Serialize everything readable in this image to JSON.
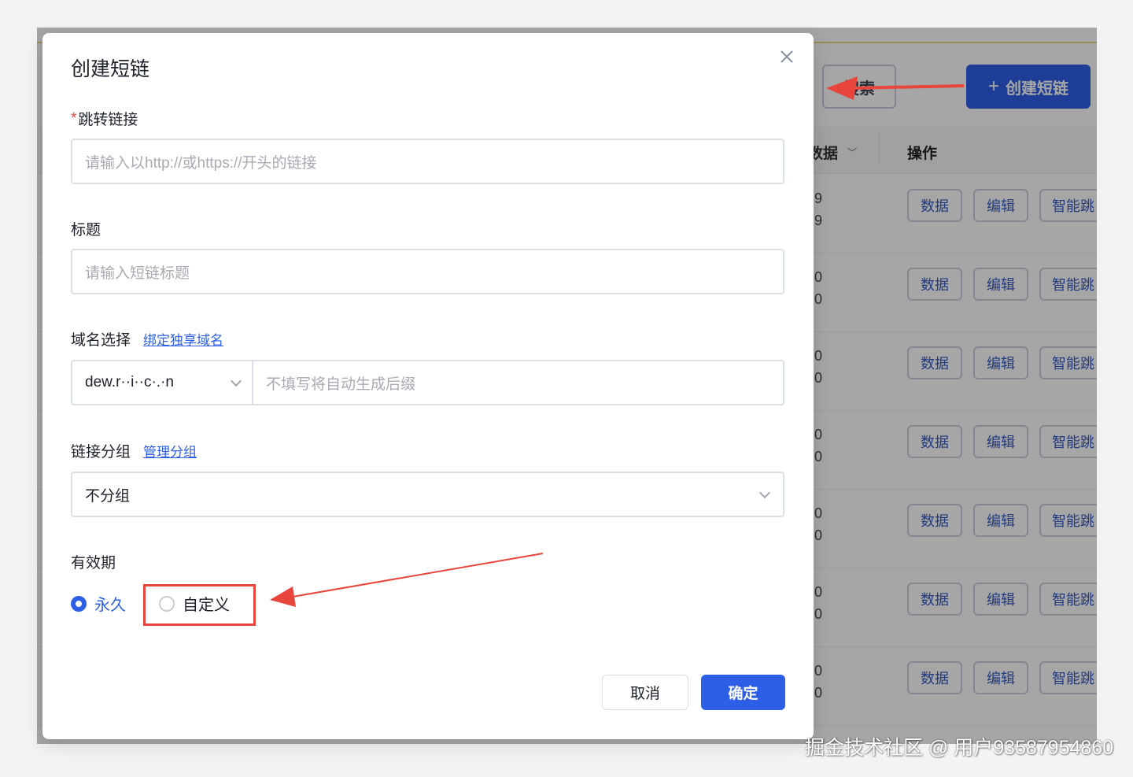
{
  "background": {
    "search_button": "搜索",
    "create_button": "创建短链",
    "create_plus": "+",
    "col_data": "数据",
    "col_op": "操作",
    "rows": [
      {
        "n1": "9",
        "n2": "9"
      },
      {
        "n1": "0",
        "n2": "0"
      },
      {
        "n1": "0",
        "n2": "0"
      },
      {
        "n1": "0",
        "n2": "0"
      },
      {
        "n1": "0",
        "n2": "0"
      },
      {
        "n1": "0",
        "n2": "0"
      },
      {
        "n1": "0",
        "n2": "0"
      }
    ],
    "row_buttons": {
      "data": "数据",
      "edit": "编辑",
      "smart": "智能跳"
    }
  },
  "modal": {
    "title": "创建短链",
    "redirect": {
      "required_mark": "*",
      "label": "跳转链接",
      "placeholder": "请输入以http://或https://开头的链接"
    },
    "title_field": {
      "label": "标题",
      "placeholder": "请输入短链标题"
    },
    "domain": {
      "label": "域名选择",
      "link": "绑定独享域名",
      "selected": "dew.r··i··c·.·n",
      "suffix_placeholder": "不填写将自动生成后缀"
    },
    "group": {
      "label": "链接分组",
      "link": "管理分组",
      "selected": "不分组"
    },
    "validity": {
      "label": "有效期",
      "options": [
        {
          "label": "永久",
          "checked": true
        },
        {
          "label": "自定义",
          "checked": false
        }
      ]
    },
    "buttons": {
      "cancel": "取消",
      "ok": "确定"
    }
  },
  "watermark": "掘金技术社区 @ 用户93587954860",
  "colors": {
    "primary": "#2d5fe6",
    "annotation_red": "#e8453c"
  }
}
